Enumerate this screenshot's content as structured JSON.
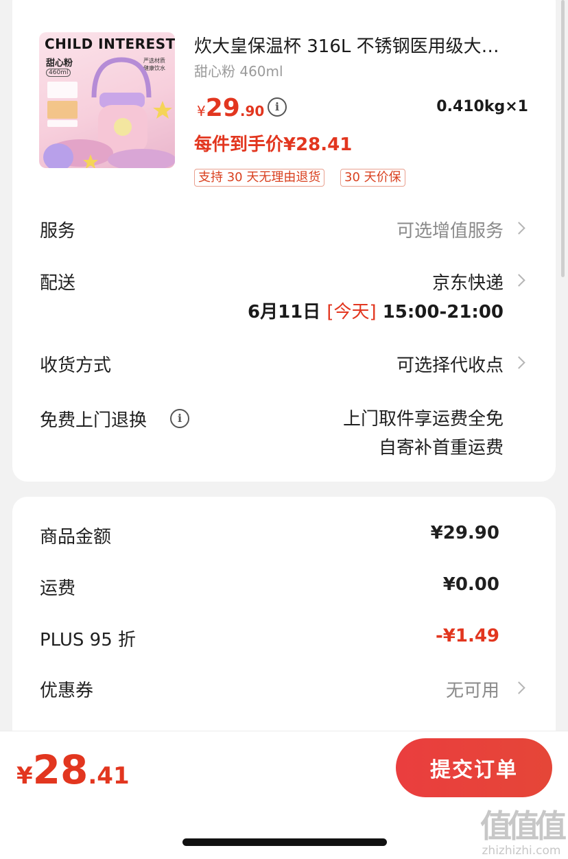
{
  "product": {
    "image_text": {
      "brand": "CHILD INTEREST",
      "subtitle": "甜心粉",
      "capacity": "460ml",
      "feature_line1": "严选材质",
      "feature_line2": "健康饮水"
    },
    "title": "炊大皇保温杯 316L 不锈钢医用级大…",
    "variant": "甜心粉 460ml",
    "price_symbol": "¥",
    "price_int": "29",
    "price_dec": ".90",
    "weight_qty": "0.410kg×1",
    "final_price_label": "每件到手价¥28.41",
    "tags": [
      "支持 30 天无理由退货",
      "30 天价保"
    ]
  },
  "details": {
    "service_label": "服务",
    "service_value": "可选增值服务",
    "delivery_label": "配送",
    "delivery_value": "京东快递",
    "delivery_date": "6月11日",
    "delivery_today": "[今天]",
    "delivery_time": "15:00-21:00",
    "receive_label": "收货方式",
    "receive_value": "可选择代收点",
    "return_label": "免费上门退换",
    "return_line1": "上门取件享运费全免",
    "return_line2": "自寄补首重运费"
  },
  "summary": {
    "goods_label": "商品金额",
    "goods_value": "¥29.90",
    "shipping_label": "运费",
    "shipping_value": "¥0.00",
    "plus_label": "PLUS 95 折",
    "plus_value": "-¥1.49",
    "coupon_label": "优惠券",
    "coupon_value": "无可用"
  },
  "bottom": {
    "total_symbol": "¥",
    "total_int": "28",
    "total_dec": ".41",
    "submit_label": "提交订单"
  },
  "watermark": {
    "text": "值值值",
    "url": "zhizhizhi.com"
  },
  "colors": {
    "accent_red": "#e2361f",
    "submit_red": "#e8403b",
    "tag_border": "#e9a08f"
  }
}
